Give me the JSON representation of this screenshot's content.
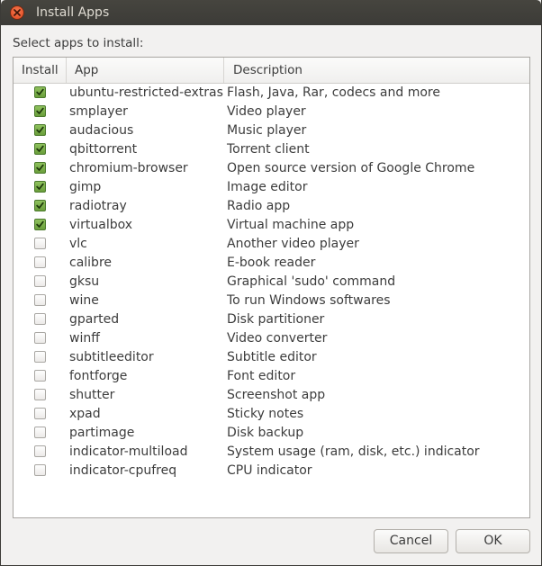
{
  "window": {
    "title": "Install Apps",
    "prompt": "Select apps to install:"
  },
  "table": {
    "headers": {
      "install": "Install",
      "app": "App",
      "description": "Description"
    },
    "rows": [
      {
        "checked": true,
        "app": "ubuntu-restricted-extras",
        "description": "Flash, Java, Rar, codecs and more"
      },
      {
        "checked": true,
        "app": "smplayer",
        "description": "Video player"
      },
      {
        "checked": true,
        "app": "audacious",
        "description": "Music player"
      },
      {
        "checked": true,
        "app": "qbittorrent",
        "description": "Torrent client"
      },
      {
        "checked": true,
        "app": "chromium-browser",
        "description": "Open source version of Google Chrome"
      },
      {
        "checked": true,
        "app": "gimp",
        "description": "Image editor"
      },
      {
        "checked": true,
        "app": "radiotray",
        "description": "Radio app"
      },
      {
        "checked": true,
        "app": "virtualbox",
        "description": "Virtual machine app"
      },
      {
        "checked": false,
        "app": "vlc",
        "description": "Another video player"
      },
      {
        "checked": false,
        "app": "calibre",
        "description": "E-book reader"
      },
      {
        "checked": false,
        "app": "gksu",
        "description": "Graphical 'sudo' command"
      },
      {
        "checked": false,
        "app": "wine",
        "description": "To run Windows softwares"
      },
      {
        "checked": false,
        "app": "gparted",
        "description": "Disk partitioner"
      },
      {
        "checked": false,
        "app": "winff",
        "description": "Video converter"
      },
      {
        "checked": false,
        "app": "subtitleeditor",
        "description": "Subtitle editor"
      },
      {
        "checked": false,
        "app": "fontforge",
        "description": "Font editor"
      },
      {
        "checked": false,
        "app": "shutter",
        "description": "Screenshot app"
      },
      {
        "checked": false,
        "app": "xpad",
        "description": "Sticky notes"
      },
      {
        "checked": false,
        "app": "partimage",
        "description": "Disk backup"
      },
      {
        "checked": false,
        "app": "indicator-multiload",
        "description": "System usage (ram, disk, etc.) indicator"
      },
      {
        "checked": false,
        "app": "indicator-cpufreq",
        "description": "CPU indicator"
      }
    ]
  },
  "buttons": {
    "cancel": "Cancel",
    "ok": "OK"
  },
  "colors": {
    "titlebar": "#3c3b37",
    "close": "#e0461e",
    "check": "#6a9e3b"
  },
  "icons": {
    "close": "close-icon",
    "check": "checkmark-icon"
  }
}
